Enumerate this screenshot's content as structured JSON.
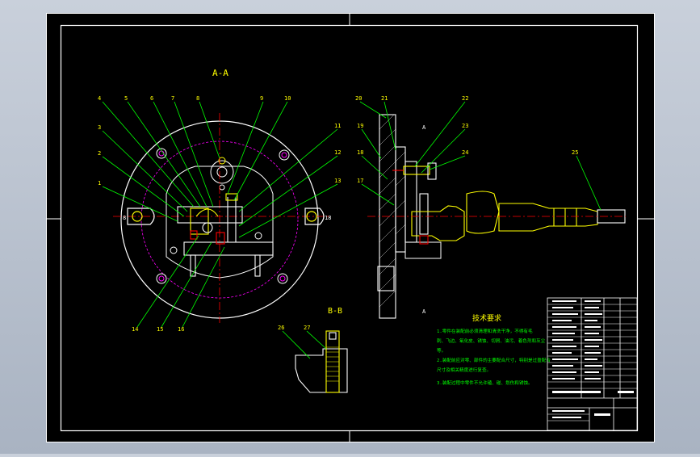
{
  "section_aa": "A-A",
  "section_bb": "B-B",
  "arrow_a_top": "A",
  "arrow_a_bottom": "A",
  "dim_left": "8",
  "dim_right": "18",
  "left_callouts": [
    "4",
    "5",
    "6",
    "7",
    "8",
    "9",
    "10",
    "3",
    "2",
    "1",
    "11",
    "12",
    "13",
    "14",
    "15",
    "16"
  ],
  "right_callouts": [
    "20",
    "21",
    "22",
    "23",
    "19",
    "18",
    "17",
    "24",
    "25"
  ],
  "bb_callouts": [
    "26",
    "27"
  ],
  "tech_req_title": "技术要求",
  "tech_req_lines": [
    "1.零件在装配前必须清理和清洗干净，不得有毛",
    "刺、飞边、氧化皮、锈蚀、切屑、油污、着色剂和灰尘",
    "等。",
    "2.装配前应对零、部件的主要配合尺寸，特别是过盈配合",
    "尺寸及相关精度进行复查。",
    "3.装配过程中零件不允许磕、碰、划伤和锈蚀。"
  ],
  "colors": {
    "frame": "#ffffff",
    "green": "#00ff00",
    "yellow": "#ffff00",
    "magenta": "#ff00ff",
    "red": "#ff0000",
    "cyan": "#00ffff"
  }
}
